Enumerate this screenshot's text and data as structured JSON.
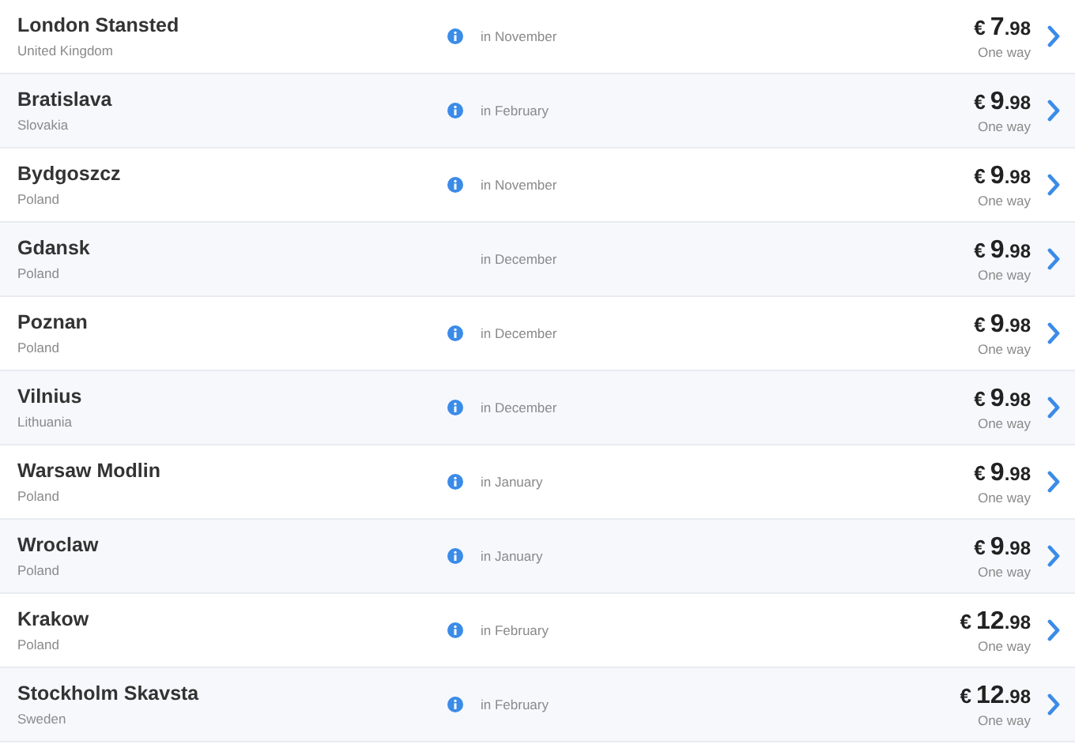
{
  "flights": [
    {
      "city": "London Stansted",
      "country": "United Kingdom",
      "info": true,
      "when": "in November",
      "currency": "€",
      "whole": "7",
      "cents": ".98",
      "fare_type": "One way"
    },
    {
      "city": "Bratislava",
      "country": "Slovakia",
      "info": true,
      "when": "in February",
      "currency": "€",
      "whole": "9",
      "cents": ".98",
      "fare_type": "One way"
    },
    {
      "city": "Bydgoszcz",
      "country": "Poland",
      "info": true,
      "when": "in November",
      "currency": "€",
      "whole": "9",
      "cents": ".98",
      "fare_type": "One way"
    },
    {
      "city": "Gdansk",
      "country": "Poland",
      "info": false,
      "when": "in December",
      "currency": "€",
      "whole": "9",
      "cents": ".98",
      "fare_type": "One way"
    },
    {
      "city": "Poznan",
      "country": "Poland",
      "info": true,
      "when": "in December",
      "currency": "€",
      "whole": "9",
      "cents": ".98",
      "fare_type": "One way"
    },
    {
      "city": "Vilnius",
      "country": "Lithuania",
      "info": true,
      "when": "in December",
      "currency": "€",
      "whole": "9",
      "cents": ".98",
      "fare_type": "One way"
    },
    {
      "city": "Warsaw Modlin",
      "country": "Poland",
      "info": true,
      "when": "in January",
      "currency": "€",
      "whole": "9",
      "cents": ".98",
      "fare_type": "One way"
    },
    {
      "city": "Wroclaw",
      "country": "Poland",
      "info": true,
      "when": "in January",
      "currency": "€",
      "whole": "9",
      "cents": ".98",
      "fare_type": "One way"
    },
    {
      "city": "Krakow",
      "country": "Poland",
      "info": true,
      "when": "in February",
      "currency": "€",
      "whole": "12",
      "cents": ".98",
      "fare_type": "One way"
    },
    {
      "city": "Stockholm Skavsta",
      "country": "Sweden",
      "info": true,
      "when": "in February",
      "currency": "€",
      "whole": "12",
      "cents": ".98",
      "fare_type": "One way"
    }
  ]
}
